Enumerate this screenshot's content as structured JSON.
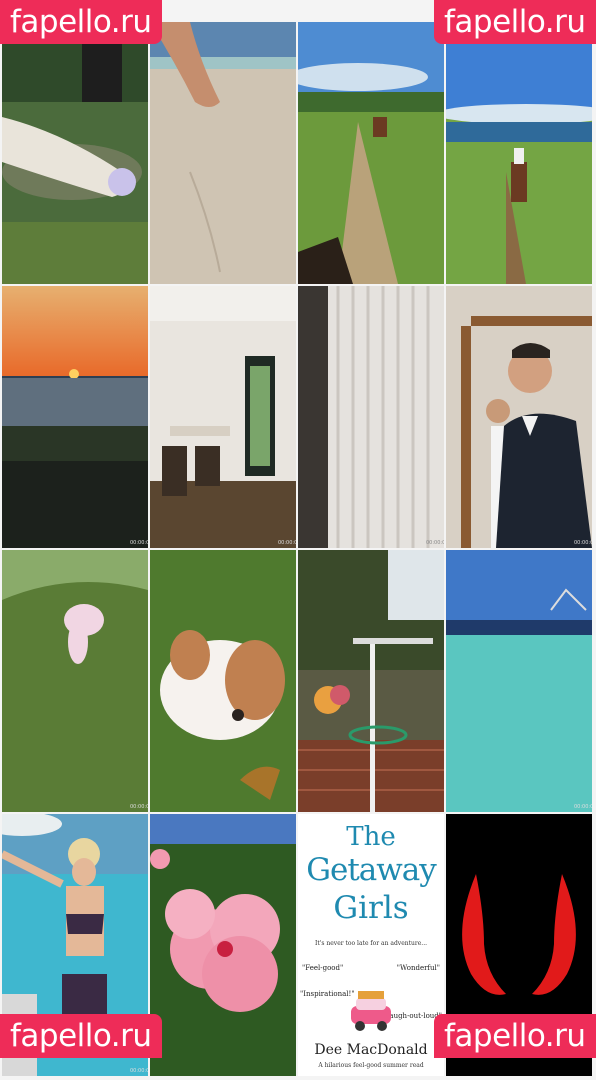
{
  "watermark": {
    "text": "fapello.ru",
    "color": "#ee2c58"
  },
  "book": {
    "title_line1": "The",
    "title_line2": "Getaway",
    "title_line3": "Girls",
    "tagline": "It's never too late for an adventure...",
    "quote_left1": "\"Feel-good\"",
    "quote_right1": "\"Wonderful\"",
    "quote_left2": "\"Inspirational!\"",
    "quote_right2": "\"Laugh-out-loud\"",
    "author": "Dee MacDonald",
    "subtitle": "A hilarious feel-good summer read"
  },
  "tiles": [
    {
      "name": "photo-woman-lying-on-rock"
    },
    {
      "name": "photo-beach-sand"
    },
    {
      "name": "photo-horse-trail"
    },
    {
      "name": "photo-horse-rider-path"
    },
    {
      "name": "photo-ocean-sunset"
    },
    {
      "name": "photo-kitchen-interior"
    },
    {
      "name": "photo-curtain-window"
    },
    {
      "name": "photo-man-in-doorway"
    },
    {
      "name": "photo-puppy-running"
    },
    {
      "name": "photo-puppy-closeup"
    },
    {
      "name": "photo-garden-pole"
    },
    {
      "name": "photo-turquoise-sea"
    },
    {
      "name": "photo-woman-swimsuit"
    },
    {
      "name": "photo-pink-hibiscus"
    },
    {
      "name": "photo-book-cover"
    },
    {
      "name": "photo-devil-horns"
    }
  ]
}
